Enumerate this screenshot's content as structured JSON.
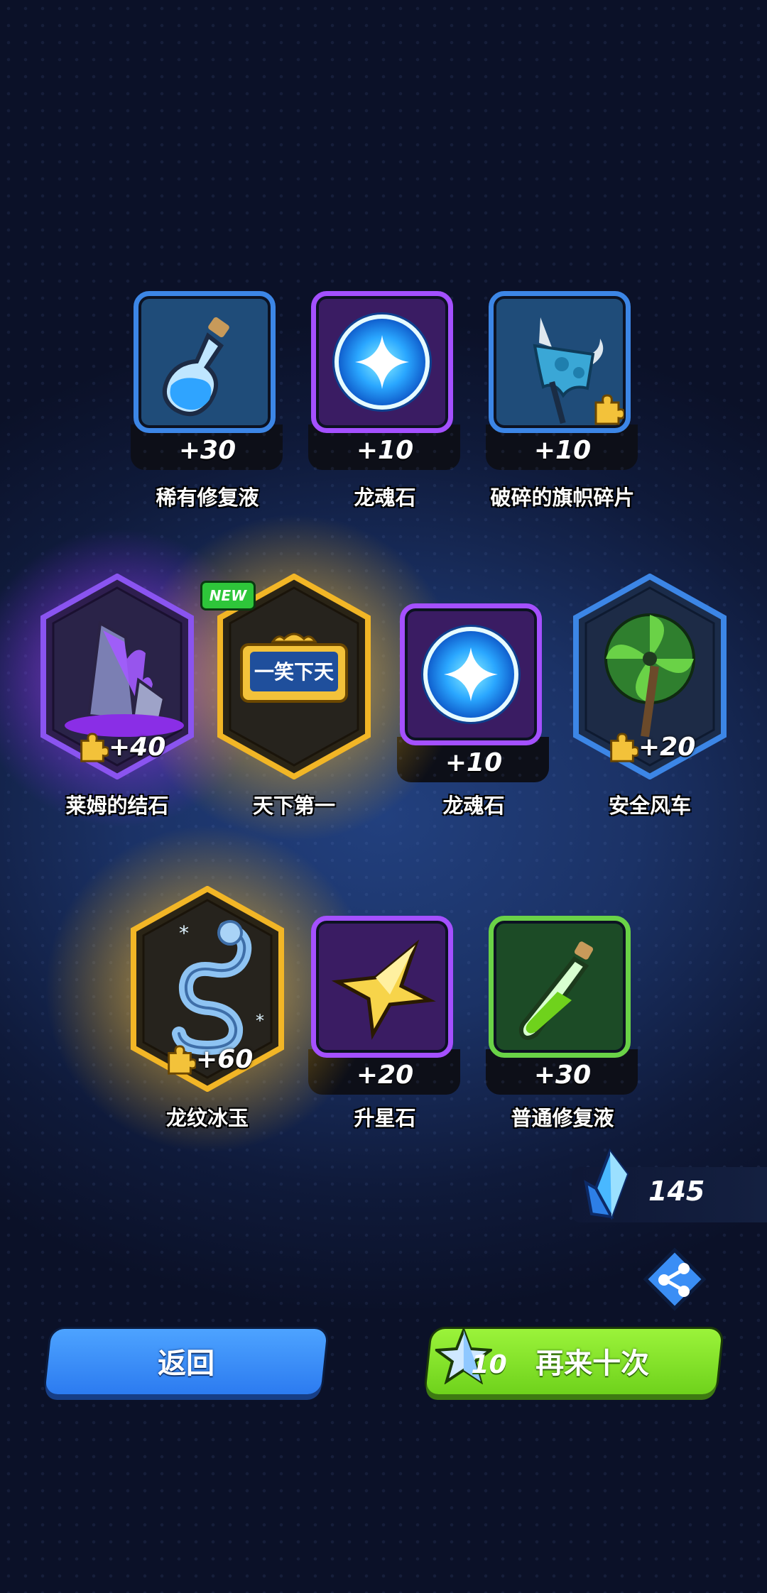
{
  "rewards": [
    {
      "name": "稀有修复液",
      "qty": "+30",
      "icon": "blue-potion-icon",
      "frame": "blue"
    },
    {
      "name": "龙魂石",
      "qty": "+10",
      "icon": "dragon-soul-orb-icon",
      "frame": "purple"
    },
    {
      "name": "破碎的旗帜碎片",
      "qty": "+10",
      "icon": "broken-banner-icon",
      "frame": "blue",
      "fragment": true
    },
    {
      "name": "莱姆的结石",
      "qty": "+40",
      "icon": "purple-crystal-icon",
      "frame": "purple-hex",
      "fragment": true
    },
    {
      "name": "天下第一",
      "qty": "",
      "icon": "title-plaque-icon",
      "frame": "gold-hex",
      "badge": "NEW",
      "plaque_text": "一笑下天"
    },
    {
      "name": "龙魂石",
      "qty": "+10",
      "icon": "dragon-soul-orb-icon",
      "frame": "purple"
    },
    {
      "name": "安全风车",
      "qty": "+20",
      "icon": "pinwheel-icon",
      "frame": "blue-hex",
      "fragment": true
    },
    {
      "name": "龙纹冰玉",
      "qty": "+60",
      "icon": "ice-dragon-jade-icon",
      "frame": "gold-hex",
      "fragment": true
    },
    {
      "name": "升星石",
      "qty": "+20",
      "icon": "star-stone-icon",
      "frame": "purple"
    },
    {
      "name": "普通修复液",
      "qty": "+30",
      "icon": "green-potion-icon",
      "frame": "green"
    }
  ],
  "currency": {
    "amount": "145",
    "icon": "blue-crystal-icon"
  },
  "buttons": {
    "back": "返回",
    "again": "再来十次",
    "again_cost": "10"
  },
  "colors": {
    "back": "#3a8ef5",
    "again": "#86e52b",
    "gold": "#f3c23a",
    "purple": "#a450ff",
    "blue": "#3c86e6"
  }
}
